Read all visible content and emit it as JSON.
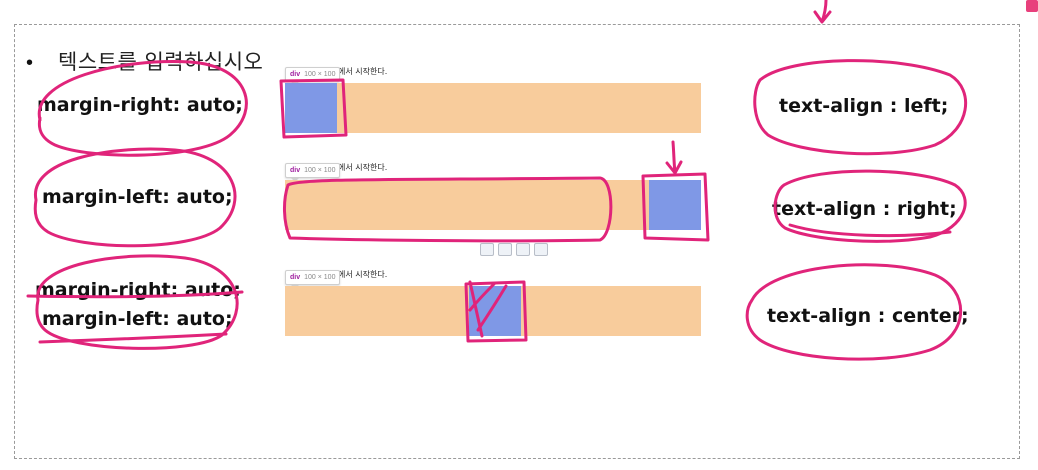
{
  "slide": {
    "bullet": "•",
    "placeholder": "텍스트를 입력하십시오"
  },
  "left_labels": {
    "row1": "margin-right: auto;",
    "row2": "margin-left: auto;",
    "row3a": "margin-right: auto;",
    "row3b": "margin-left: auto;"
  },
  "right_labels": {
    "row1": "text-align : left;",
    "row2": "text-align : right;",
    "row3": "text-align : center;"
  },
  "demos": [
    {
      "tag": "div",
      "size": "100 × 100",
      "caption": "에서 시작한다."
    },
    {
      "tag": "div",
      "size": "100 × 100",
      "caption": "에서 시작한다."
    },
    {
      "tag": "div",
      "size": "100 × 100",
      "caption": "에서 시작한다."
    }
  ],
  "colors": {
    "bar": "#f8cc9c",
    "box": "#7f98e6",
    "annotation_ink": "#e0247a",
    "tooltip_tag": "#a020a0"
  },
  "icons": [
    "pen-annotation-icon",
    "image-insert-icon",
    "screen-icon",
    "link-icon"
  ]
}
